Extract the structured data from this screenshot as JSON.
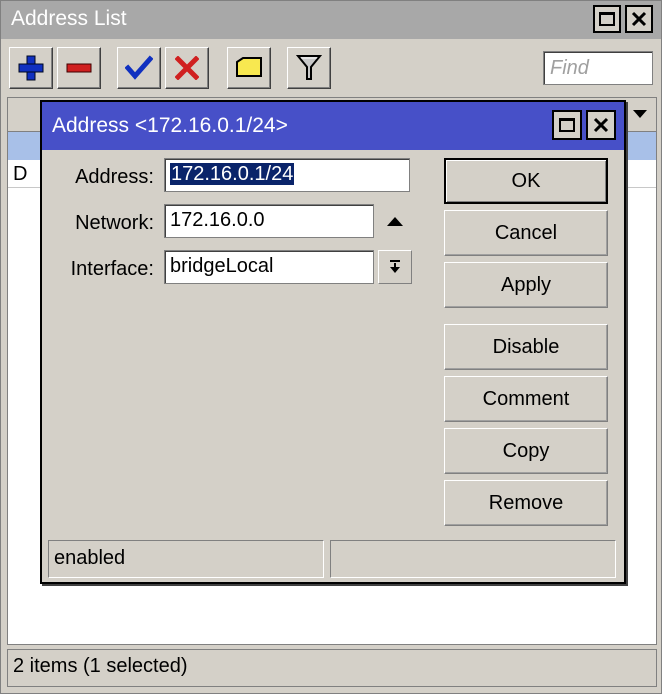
{
  "window": {
    "title": "Address List"
  },
  "toolbar": {
    "add_icon": "plus-icon",
    "remove_icon": "minus-icon",
    "enable_icon": "check-icon",
    "disable_icon": "x-icon",
    "comment_icon": "note-icon",
    "filter_icon": "filter-icon",
    "find_placeholder": "Find"
  },
  "list": {
    "rows": [
      {
        "flag": "",
        "selected": true
      },
      {
        "flag": "D",
        "selected": false
      }
    ]
  },
  "status_bar": {
    "text": "2 items (1 selected)"
  },
  "dialog": {
    "title": "Address <172.16.0.1/24>",
    "fields": {
      "address_label": "Address:",
      "address_value": "172.16.0.1/24",
      "network_label": "Network:",
      "network_value": "172.16.0.0",
      "interface_label": "Interface:",
      "interface_value": "bridgeLocal"
    },
    "buttons": {
      "ok": "OK",
      "cancel": "Cancel",
      "apply": "Apply",
      "disable": "Disable",
      "comment": "Comment",
      "copy": "Copy",
      "remove": "Remove"
    },
    "status": {
      "left": "enabled",
      "right": ""
    }
  },
  "colors": {
    "dialog_title_bg": "#4750c8",
    "outer_title_bg": "#a8a8a8",
    "selection_bg": "#a8c0e8",
    "text_selection_bg": "#0a246a",
    "add_icon_color": "#1030c0",
    "remove_icon_color": "#d02020"
  }
}
